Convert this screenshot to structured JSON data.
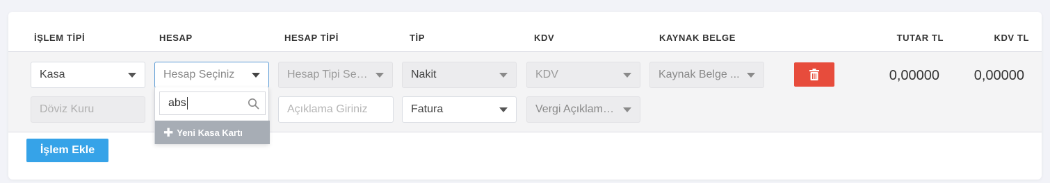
{
  "headers": {
    "islem_tipi": "İŞLEM TİPİ",
    "hesap": "HESAP",
    "hesap_tipi": "HESAP TİPİ",
    "tip": "TİP",
    "kdv": "KDV",
    "kaynak_belge": "KAYNAK BELGE",
    "tutar_tl": "TUTAR TL",
    "kdv_tl": "KDV TL"
  },
  "row": {
    "islem_tipi": "Kasa",
    "hesap_placeholder": "Hesap Seçiniz",
    "hesap_tipi_placeholder": "Hesap Tipi Seç...",
    "tip": "Nakit",
    "kdv_placeholder": "KDV",
    "kaynak_belge_placeholder": "Kaynak Belge ...",
    "doviz_kuru_placeholder": "Döviz Kuru",
    "aciklama_placeholder": "Açıklama Giriniz",
    "tip2": "Fatura",
    "vergi_aciklamasi_placeholder": "Vergi Açıklaması",
    "tutar_tl": "0,00000",
    "kdv_tl": "0,00000"
  },
  "dropdown": {
    "search_value": "abs",
    "new_item_label": "Yeni Kasa Kartı"
  },
  "actions": {
    "add_label": "İşlem Ekle"
  },
  "colors": {
    "delete_button": "#e74c3c",
    "add_button": "#36a3e8",
    "dropdown_new_item": "#a7adb5"
  },
  "icons": {
    "delete": "trash-icon",
    "search": "search-icon",
    "new_item": "plus-icon",
    "dropdown": "caret-down-icon"
  }
}
